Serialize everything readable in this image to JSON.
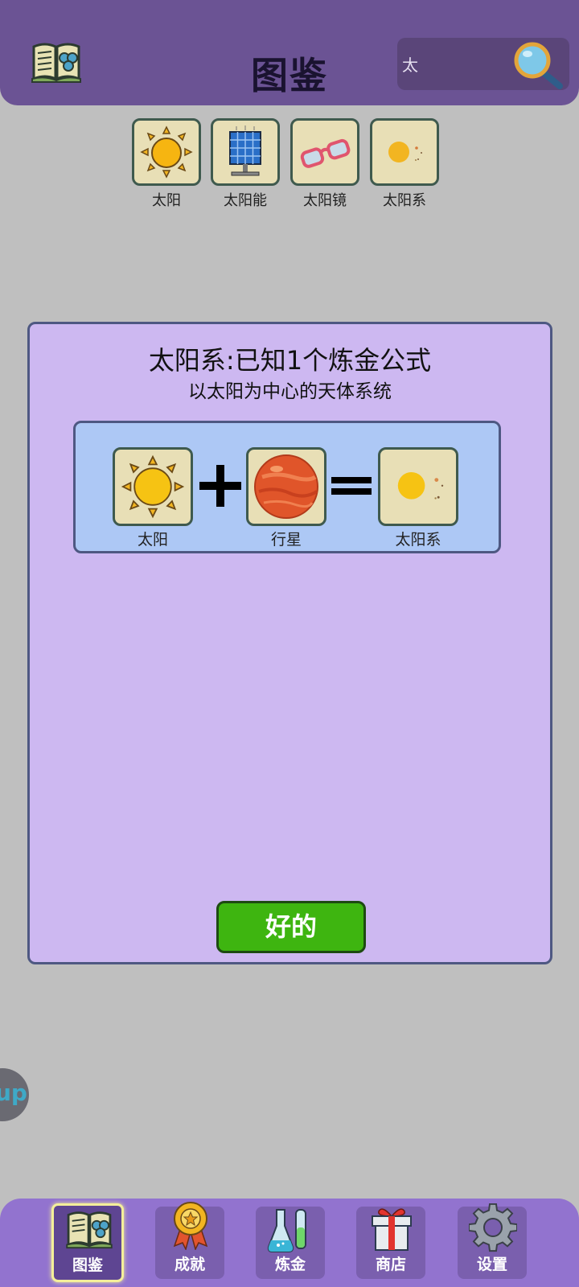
{
  "header": {
    "title": "图鉴",
    "search": {
      "value": "太"
    }
  },
  "results": [
    {
      "label": "太阳",
      "icon": "sun-icon"
    },
    {
      "label": "太阳能",
      "icon": "solar-panel-icon"
    },
    {
      "label": "太阳镜",
      "icon": "sunglasses-icon"
    },
    {
      "label": "太阳系",
      "icon": "solar-system-icon"
    }
  ],
  "dialog": {
    "title": "太阳系:已知1个炼金公式",
    "subtitle": "以太阳为中心的天体系统",
    "formula": {
      "input1": {
        "label": "太阳",
        "icon": "sun-icon"
      },
      "input2": {
        "label": "行星",
        "icon": "planet-icon"
      },
      "output": {
        "label": "太阳系",
        "icon": "solar-system-icon"
      }
    },
    "ok_label": "好的"
  },
  "side_float": {
    "text": "up"
  },
  "nav": [
    {
      "label": "图鉴",
      "icon": "book-icon",
      "active": true
    },
    {
      "label": "成就",
      "icon": "medal-icon",
      "active": false
    },
    {
      "label": "炼金",
      "icon": "flask-icon",
      "active": false
    },
    {
      "label": "商店",
      "icon": "gift-icon",
      "active": false
    },
    {
      "label": "设置",
      "icon": "gear-icon",
      "active": false
    }
  ],
  "colors": {
    "header_bg": "#6b5394",
    "dialog_bg": "#cdb8f1",
    "formula_bg": "#adc8f5",
    "ok_button": "#3eb510",
    "nav_bg": "#9273cf"
  }
}
